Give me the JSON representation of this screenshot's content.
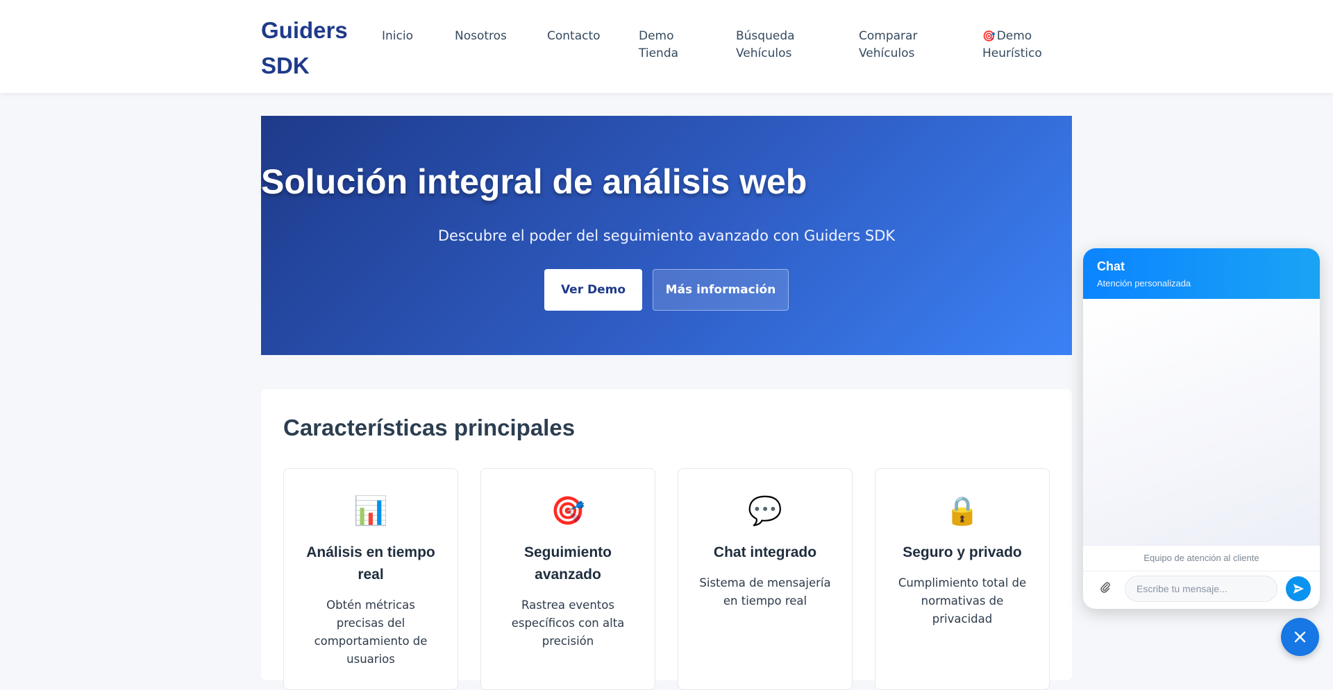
{
  "brand": {
    "name": "Guiders SDK"
  },
  "nav": {
    "items": [
      {
        "label": "Inicio"
      },
      {
        "label": "Nosotros"
      },
      {
        "label": "Contacto"
      },
      {
        "label": "Demo Tienda"
      },
      {
        "label": "Búsqueda Vehículos"
      },
      {
        "label": "Comparar Vehículos"
      },
      {
        "label": "Demo Heurístico",
        "icon": "target-icon"
      }
    ]
  },
  "hero": {
    "title": "Solución integral de análisis web",
    "subtitle": "Descubre el poder del seguimiento avanzado con Guiders SDK",
    "primary_button": "Ver Demo",
    "secondary_button": "Más información"
  },
  "features": {
    "title": "Características principales",
    "cards": [
      {
        "icon": "📊",
        "icon_name": "bar-chart-icon",
        "title": "Análisis en tiempo real",
        "description": "Obtén métricas precisas del comportamiento de usuarios"
      },
      {
        "icon": "🎯",
        "icon_name": "target-icon",
        "title": "Seguimiento avanzado",
        "description": "Rastrea eventos específicos con alta precisión"
      },
      {
        "icon": "💬",
        "icon_name": "speech-bubble-icon",
        "title": "Chat integrado",
        "description": "Sistema de mensajería en tiempo real"
      },
      {
        "icon": "🔒",
        "icon_name": "lock-icon",
        "title": "Seguro y privado",
        "description": "Cumplimiento total de normativas de privacidad"
      }
    ]
  },
  "chat": {
    "title": "Chat",
    "subtitle": "Atención personalizada",
    "team_label": "Equipo de atención al cliente",
    "input_placeholder": "Escribe tu mensaje...",
    "input_value": "",
    "accent_color": "#0b93f0"
  },
  "colors": {
    "brand": "#1e3a8a",
    "hero_gradient_start": "#1e3a8a",
    "hero_gradient_end": "#3b82f6",
    "chat_header": "#0b84ff"
  }
}
